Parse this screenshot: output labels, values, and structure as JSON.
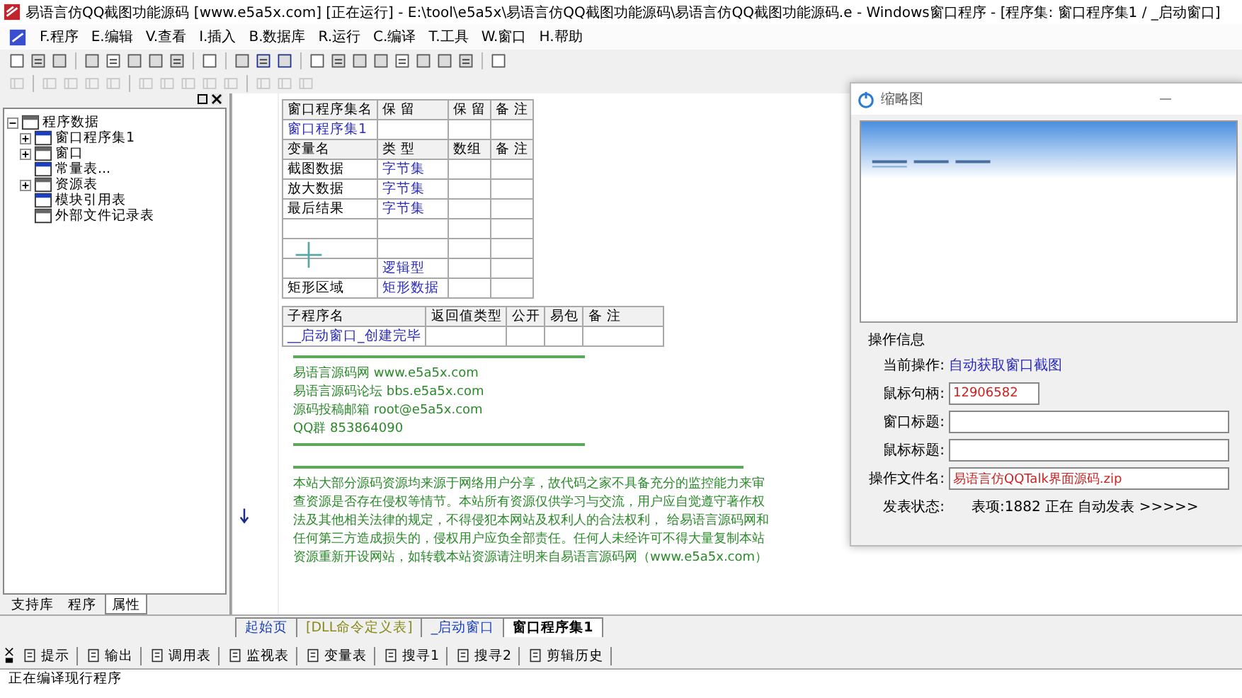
{
  "window": {
    "title": "易语言仿QQ截图功能源码 [www.e5a5x.com] [正在运行] - E:\\tool\\e5a5x\\易语言仿QQ截图功能源码\\易语言仿QQ截图功能源码.e - Windows窗口程序 - [程序集: 窗口程序集1 / _启动窗口]"
  },
  "menu": [
    "F.程序",
    "E.编辑",
    "V.查看",
    "I.插入",
    "B.数据库",
    "R.运行",
    "C.编译",
    "T.工具",
    "W.窗口",
    "H.帮助"
  ],
  "sidebar": {
    "tree": [
      {
        "label": "程序数据",
        "expanded": true,
        "children": [
          {
            "label": "窗口程序集1",
            "expanded": false
          },
          {
            "label": "窗口",
            "expanded": false
          },
          {
            "label": "常量表..."
          },
          {
            "label": "资源表",
            "expanded": false
          },
          {
            "label": "模块引用表"
          },
          {
            "label": "外部文件记录表"
          }
        ]
      }
    ],
    "tabs": [
      {
        "label": "支持库",
        "selected": false
      },
      {
        "label": "程序",
        "selected": false
      },
      {
        "label": "属性",
        "selected": true
      }
    ]
  },
  "editor": {
    "class_table": {
      "columns": [
        "窗口程序集名",
        "保 留",
        "保 留",
        "备 注"
      ],
      "row": [
        "窗口程序集1"
      ]
    },
    "var_table": {
      "columns": [
        "变量名",
        "类 型",
        "数组",
        "备 注"
      ],
      "rows": [
        {
          "name": "截图数据",
          "type": "字节集"
        },
        {
          "name": "放大数据",
          "type": "字节集"
        },
        {
          "name": "最后结果",
          "type": "字节集"
        },
        {
          "name": "",
          "type": ""
        },
        {
          "name": "",
          "type": ""
        },
        {
          "name": "",
          "type": "逻辑型"
        },
        {
          "name": "矩形区域",
          "type": "矩形数据"
        }
      ]
    },
    "sub_table": {
      "columns": [
        "子程序名",
        "返回值类型",
        "公开",
        "易包",
        "备 注"
      ],
      "row": [
        "__启动窗口_创建完毕"
      ]
    },
    "comment_blocks": [
      {
        "lines": [
          "易语言源码网      www.e5a5x.com",
          "易语言源码论坛      bbs.e5a5x.com",
          "源码投稿邮箱   root@e5a5x.com",
          "QQ群      853864090"
        ]
      },
      {
        "lines": [
          "本站大部分源码资源均来源于网络用户分享，故代码之家不具备充分的监控能力来审",
          "查资源是否存在侵权等情节。本站所有资源仅供学习与交流，用户应自觉遵守著作权",
          "法及其他相关法律的规定，不得侵犯本网站及权利人的合法权利， 给易语言源码网和",
          "任何第三方造成损失的，侵权用户应负全部责任。任何人未经许可不得大量复制本站",
          "资源重新开设网站，如转载本站资源请注明来自易语言源码网（www.e5a5x.com）"
        ]
      }
    ],
    "tabs": [
      {
        "label": "起始页",
        "selected": false,
        "color": "#1a3fbf"
      },
      {
        "label": "[DLL命令定义表]",
        "selected": false,
        "color": "#8a8a1a"
      },
      {
        "label": "_启动窗口",
        "selected": false,
        "color": "#1a3fbf"
      },
      {
        "label": "窗口程序集1",
        "selected": true,
        "color": "#000000"
      }
    ]
  },
  "dialog": {
    "title": "缩略图",
    "section": "操作信息",
    "rows": [
      {
        "kind": "text",
        "label": "当前操作:",
        "value": "自动获取窗口截图"
      },
      {
        "kind": "short-field",
        "label": "鼠标句柄:",
        "value": "12906582"
      },
      {
        "kind": "field",
        "label": "窗口标题:",
        "value": ""
      },
      {
        "kind": "field",
        "label": "鼠标标题:",
        "value": ""
      },
      {
        "kind": "field",
        "label": "操作文件名:",
        "value": "易语言仿QQTalk界面源码.zip"
      },
      {
        "kind": "status",
        "label": "发表状态:",
        "value": "表项:1882  正在  自动发表  >>>>>"
      }
    ]
  },
  "bottom_tabs": [
    "提示",
    "输出",
    "调用表",
    "监视表",
    "变量表",
    "搜寻1",
    "搜寻2",
    "剪辑历史"
  ],
  "output": {
    "lines": [
      "正在编译现行程序"
    ]
  }
}
